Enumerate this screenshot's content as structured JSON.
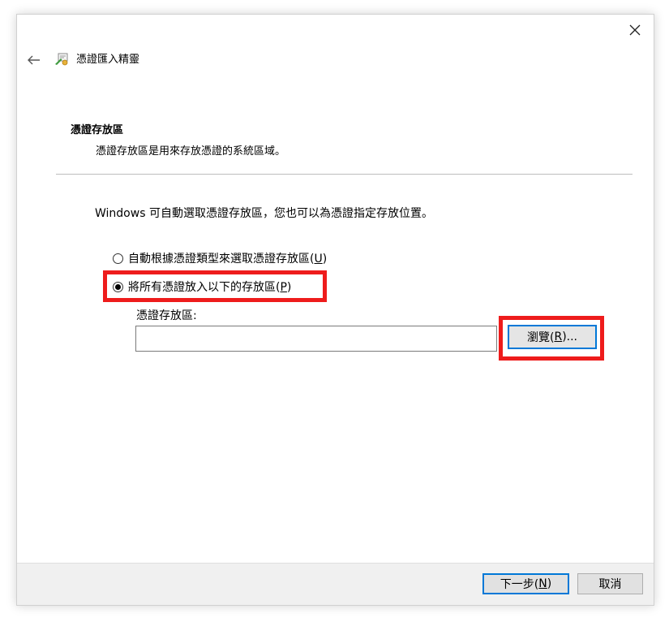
{
  "window": {
    "title": "憑證匯入精靈",
    "icons": {
      "close": "close-icon",
      "back": "back-arrow-icon",
      "wizard": "certificate-wizard-icon"
    }
  },
  "page": {
    "title": "憑證存放區",
    "description": "憑證存放區是用來存放憑證的系統區域。"
  },
  "intro_text": "Windows 可自動選取憑證存放區，您也可以為憑證指定存放位置。",
  "options": [
    {
      "label_pre": "自動根據憑證類型來選取憑證存放區(",
      "accel": "U",
      "label_post": ")",
      "selected": false
    },
    {
      "label_pre": "將所有憑證放入以下的存放區(",
      "accel": "P",
      "label_post": ")",
      "selected": true
    }
  ],
  "store": {
    "label": "憑證存放區:",
    "value": "",
    "browse_pre": "瀏覽(",
    "browse_accel": "R",
    "browse_post": ")..."
  },
  "footer": {
    "next_pre": "下一步(",
    "next_accel": "N",
    "next_post": ")",
    "cancel": "取消"
  },
  "colors": {
    "highlight": "#ee1c1c",
    "focus": "#0078d7",
    "footer_bg": "#f0f0f0"
  }
}
